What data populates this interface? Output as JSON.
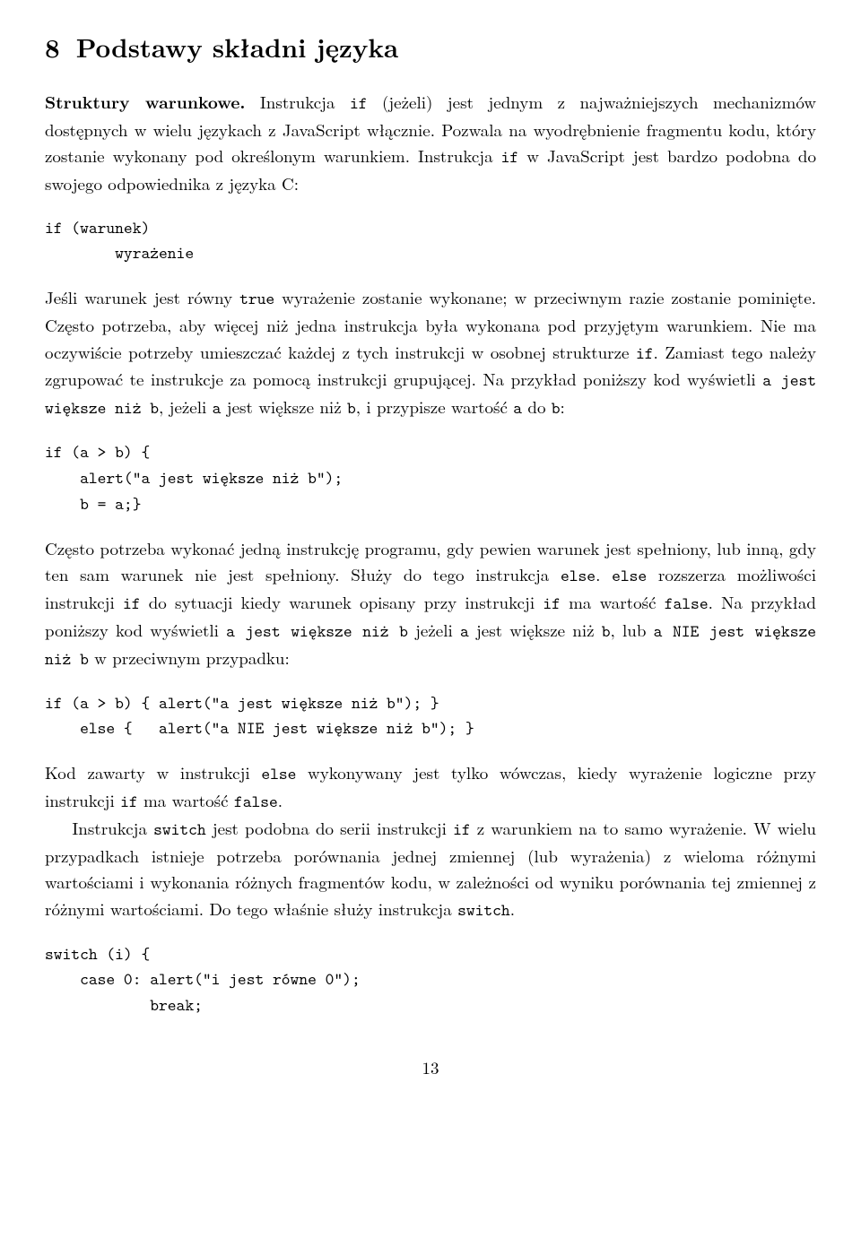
{
  "heading": {
    "number": "8",
    "title": "Podstawy składni języka"
  },
  "para1": {
    "bold_lead": "Struktury warunkowe.",
    "text_a": " Instrukcja ",
    "tt_if": "if",
    "text_b": " (jeżeli) jest jednym z najważniejszych mechanizmów dostępnych w wielu językach z JavaScript włącznie. Pozwala na wyodrębnienie fragmentu kodu, który zostanie wykonany pod określonym warunkiem. Instrukcja ",
    "tt_if2": "if",
    "text_c": " w JavaScript jest bardzo podobna do swojego odpowiednika z języka C:"
  },
  "code1": "if (warunek)\n        wyrażenie",
  "para2": {
    "text_a": "Jeśli warunek jest równy ",
    "tt_true": "true",
    "text_b": " wyrażenie zostanie wykonane; w przeciwnym razie zostanie pominięte. Często potrzeba, aby więcej niż jedna instrukcja była wykonana pod przyjętym warunkiem. Nie ma oczywiście potrzeby umieszczać każdej z tych instrukcji w osobnej strukturze ",
    "tt_if": "if",
    "text_c": ". Zamiast tego należy zgrupować te instrukcje za pomocą instrukcji grupującej. Na przykład poniższy kod wyświetli ",
    "tt_msg": "a jest większe niż b",
    "text_d": ", jeżeli ",
    "tt_a": "a",
    "text_e": " jest większe niż ",
    "tt_b": "b",
    "text_f": ", i przypisze wartość ",
    "tt_a2": "a",
    "text_g": " do ",
    "tt_b2": "b",
    "text_h": ":"
  },
  "code2": "if (a > b) {\n    alert(\"a jest większe niż b\");\n    b = a;}",
  "para3": {
    "text_a": "Często potrzeba wykonać jedną instrukcję programu, gdy pewien warunek jest spełniony, lub inną, gdy ten sam warunek nie jest spełniony. Służy do tego instrukcja ",
    "tt_else": "else",
    "text_b": ". ",
    "tt_else2": "else",
    "text_c": " rozszerza możliwości instrukcji ",
    "tt_if": "if",
    "text_d": " do sytuacji kiedy warunek opisany przy instrukcji ",
    "tt_if2": "if",
    "text_e": " ma wartość ",
    "tt_false": "false",
    "text_f": ". Na przykład poniższy kod wyświetli ",
    "tt_msg1": "a jest większe niż b",
    "text_g": " jeżeli ",
    "tt_a": "a",
    "text_h": " jest większe niż ",
    "tt_b": "b",
    "text_i": ", lub ",
    "tt_msg2": "a NIE jest większe niż b",
    "text_j": " w przeciwnym przypadku:"
  },
  "code3": "if (a > b) { alert(\"a jest większe niż b\"); }\n    else {   alert(\"a NIE jest większe niż b\"); }",
  "para4": {
    "text_a": "Kod zawarty w instrukcji ",
    "tt_else": "else",
    "text_b": " wykonywany jest tylko wówczas, kiedy wyrażenie logiczne przy instrukcji ",
    "tt_if": "if",
    "text_c": " ma wartość ",
    "tt_false": "false",
    "text_d": "."
  },
  "para5": {
    "text_a": "Instrukcja ",
    "tt_switch": "switch",
    "text_b": " jest podobna do serii instrukcji ",
    "tt_if": "if",
    "text_c": " z warunkiem na to samo wyrażenie. W wielu przypadkach istnieje potrzeba porównania jednej zmiennej (lub wyrażenia) z wieloma różnymi wartościami i wykonania różnych fragmentów kodu, w zależności od wyniku porównania tej zmiennej z różnymi wartościami. Do tego właśnie służy instrukcja ",
    "tt_switch2": "switch",
    "text_d": "."
  },
  "code4": "switch (i) {\n    case 0: alert(\"i jest równe 0\");\n            break;",
  "pagenum": "13"
}
